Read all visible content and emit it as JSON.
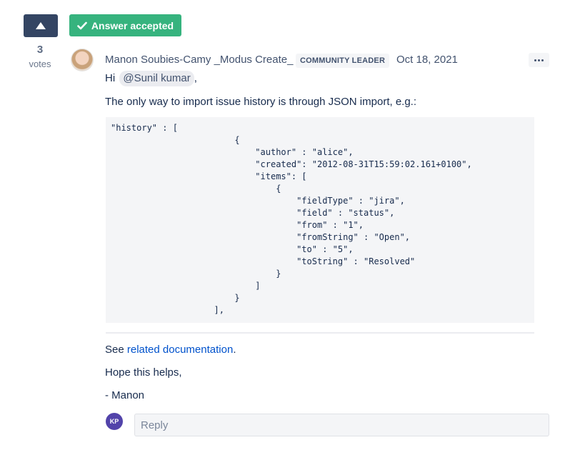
{
  "vote": {
    "count": "3",
    "label": "votes",
    "icon": "upvote-triangle-icon"
  },
  "accepted": {
    "label": "Answer accepted",
    "icon": "checkmark-icon",
    "color": "#36b37e"
  },
  "post": {
    "author": "Manon Soubies-Camy _Modus Create_",
    "badge": "COMMUNITY LEADER",
    "date": "Oct 18, 2021",
    "greeting": "Hi",
    "mention": "@Sunil kumar",
    "greeting_suffix": ",",
    "intro": "The only way to import issue history is through JSON import, e.g.:",
    "code": "\"history\" : [\n                        {\n                            \"author\" : \"alice\",\n                            \"created\": \"2012-08-31T15:59:02.161+0100\",\n                            \"items\": [\n                                {\n                                    \"fieldType\" : \"jira\",\n                                    \"field\" : \"status\",\n                                    \"from\" : \"1\",\n                                    \"fromString\" : \"Open\",\n                                    \"to\" : \"5\",\n                                    \"toString\" : \"Resolved\"\n                                }\n                            ]\n                        }\n                    ],",
    "see_prefix": "See",
    "link_text": "related documentation",
    "see_suffix": ".",
    "hope": "Hope this helps,",
    "signature": "- Manon"
  },
  "reply": {
    "avatar_initials": "KP",
    "avatar_color": "#5243aa",
    "placeholder": "Reply"
  }
}
